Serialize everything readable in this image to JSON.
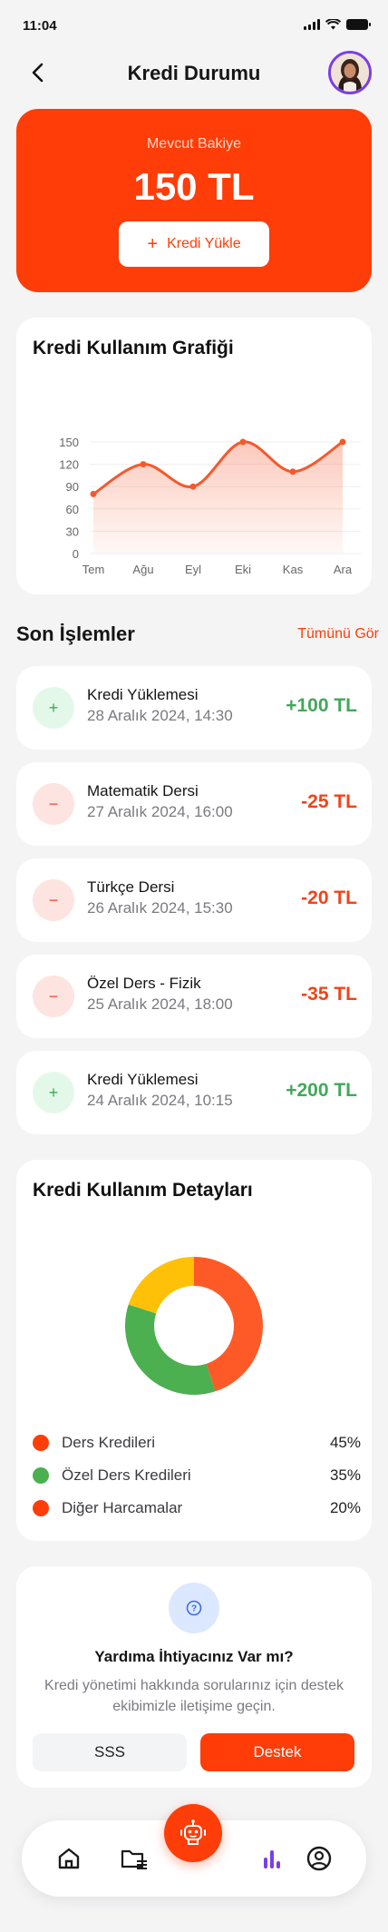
{
  "status_bar": {
    "time": "11:04"
  },
  "header": {
    "title": "Kredi Durumu"
  },
  "balance": {
    "label": "Mevcut Bakiye",
    "amount": "150 TL",
    "button_label": "Kredi Yükle"
  },
  "usage_chart": {
    "title": "Kredi Kullanım Grafiği"
  },
  "chart_data": [
    {
      "type": "area",
      "title": "Kredi Kullanım Grafiği",
      "categories": [
        "Tem",
        "Ağu",
        "Eyl",
        "Eki",
        "Kas",
        "Ara"
      ],
      "values": [
        80,
        120,
        90,
        150,
        110,
        150
      ],
      "y_ticks": [
        "0",
        "30",
        "60",
        "90",
        "120",
        "150"
      ],
      "ylim": [
        0,
        150
      ],
      "grid": true,
      "color": "#f4592e"
    },
    {
      "type": "pie",
      "title": "Kredi Kullanım Detayları",
      "categories": [
        "Ders Kredileri",
        "Özel Ders Kredileri",
        "Diğer Harcamalar"
      ],
      "values": [
        45,
        35,
        20
      ],
      "colors": [
        "#fe5a28",
        "#4caf50",
        "#ffc107"
      ]
    }
  ],
  "transactions": {
    "title": "Son İşlemler",
    "see_all": "Tümünü Gör",
    "items": [
      {
        "name": "Kredi Yüklemesi",
        "date": "28 Aralık 2024, 14:30",
        "amount": "+100 TL",
        "icon": "+",
        "kind": "plus"
      },
      {
        "name": "Matematik Dersi",
        "date": "27 Aralık 2024, 16:00",
        "amount": "-25 TL",
        "icon": "−",
        "kind": "minus"
      },
      {
        "name": "Türkçe Dersi",
        "date": "26 Aralık 2024, 15:30",
        "amount": "-20 TL",
        "icon": "−",
        "kind": "minus"
      },
      {
        "name": "Özel Ders - Fizik",
        "date": "25 Aralık 2024, 18:00",
        "amount": "-35 TL",
        "icon": "−",
        "kind": "minus"
      },
      {
        "name": "Kredi Yüklemesi",
        "date": "24 Aralık 2024, 10:15",
        "amount": "+200 TL",
        "icon": "+",
        "kind": "plus"
      }
    ]
  },
  "details": {
    "title": "Kredi Kullanım Detayları",
    "legend": [
      {
        "label": "Ders Kredileri",
        "pct": "45%",
        "color": "#fe3d08"
      },
      {
        "label": "Özel Ders Kredileri",
        "pct": "35%",
        "color": "#4caf50"
      },
      {
        "label": "Diğer Harcamalar",
        "pct": "20%",
        "color": "#fe3d08"
      }
    ]
  },
  "help": {
    "title": "Yardıma İhtiyacınız Var mı?",
    "description": "Kredi yönetimi hakkında sorularınız için destek ekibimizle iletişime geçin.",
    "faq_label": "SSS",
    "support_label": "Destek"
  },
  "nav": {
    "items": [
      "home-icon",
      "folder-icon",
      "robot-icon",
      "chart-icon",
      "profile-icon"
    ],
    "active": "chart-icon",
    "accent": "#7b3fe4"
  }
}
